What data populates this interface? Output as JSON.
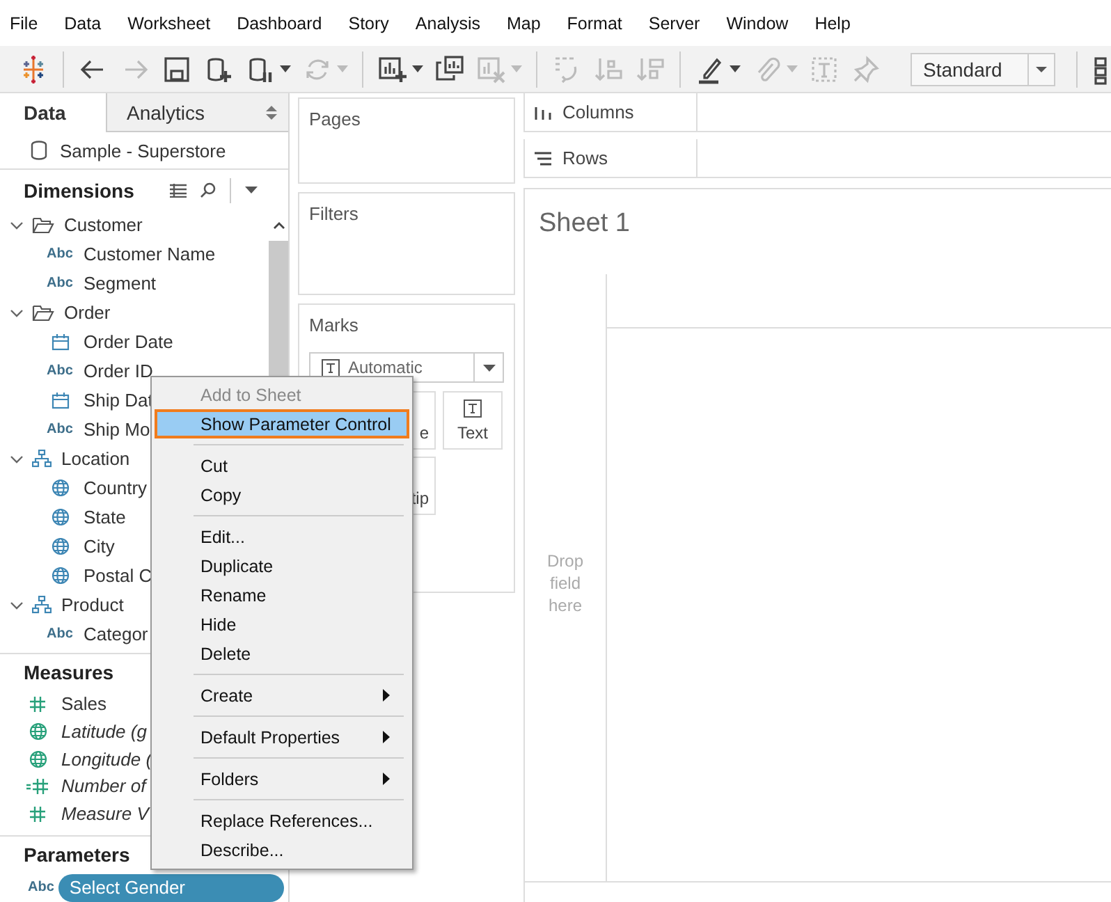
{
  "menu_bar": [
    "File",
    "Data",
    "Worksheet",
    "Dashboard",
    "Story",
    "Analysis",
    "Map",
    "Format",
    "Server",
    "Window",
    "Help"
  ],
  "toolbar": {
    "buttons": [
      {
        "kind": "logo",
        "disabled": false,
        "dropdown": false
      },
      {
        "kind": "separator"
      },
      {
        "kind": "back",
        "disabled": false,
        "dropdown": false
      },
      {
        "kind": "forward",
        "disabled": true,
        "dropdown": false
      },
      {
        "kind": "save",
        "disabled": false,
        "dropdown": false
      },
      {
        "kind": "new_datasource",
        "disabled": false,
        "dropdown": false
      },
      {
        "kind": "pause_datasource",
        "disabled": false,
        "dropdown": true
      },
      {
        "kind": "refresh",
        "disabled": true,
        "dropdown": true
      },
      {
        "kind": "separator"
      },
      {
        "kind": "new_sheet",
        "disabled": false,
        "dropdown": true
      },
      {
        "kind": "duplicate_sheet",
        "disabled": false,
        "dropdown": false
      },
      {
        "kind": "clear_sheet",
        "disabled": true,
        "dropdown": true
      },
      {
        "kind": "separator"
      },
      {
        "kind": "swap",
        "disabled": true,
        "dropdown": false
      },
      {
        "kind": "sort_ascending",
        "disabled": true,
        "dropdown": false
      },
      {
        "kind": "sort_descending",
        "disabled": true,
        "dropdown": false
      },
      {
        "kind": "separator"
      },
      {
        "kind": "highlight",
        "disabled": false,
        "dropdown": true
      },
      {
        "kind": "annotate",
        "disabled": true,
        "dropdown": true
      },
      {
        "kind": "labels",
        "disabled": true,
        "dropdown": false
      },
      {
        "kind": "pin",
        "disabled": true,
        "dropdown": false
      },
      {
        "kind": "fit"
      },
      {
        "kind": "separator"
      },
      {
        "kind": "cards",
        "disabled": false,
        "dropdown": false
      }
    ],
    "fit": "Standard"
  },
  "data_pane": {
    "tabs": [
      {
        "label": "Data",
        "selected": true
      },
      {
        "label": "Analytics",
        "selected": false
      }
    ],
    "datasource": "Sample - Superstore",
    "dimensions": {
      "title": "Dimensions",
      "items": [
        {
          "kind": "folder",
          "name": "Customer",
          "expanded": true,
          "children": [
            {
              "kind": "string",
              "type_label": "Abc",
              "name": "Customer Name"
            },
            {
              "kind": "string",
              "type_label": "Abc",
              "name": "Segment"
            }
          ]
        },
        {
          "kind": "folder",
          "name": "Order",
          "expanded": true,
          "children": [
            {
              "kind": "date",
              "name": "Order Date"
            },
            {
              "kind": "string",
              "type_label": "Abc",
              "name": "Order ID"
            },
            {
              "kind": "date",
              "name": "Ship Dat"
            },
            {
              "kind": "string",
              "type_label": "Abc",
              "name": "Ship Mo"
            }
          ]
        },
        {
          "kind": "hierarchy",
          "name": "Location",
          "expanded": true,
          "children": [
            {
              "kind": "geo",
              "name": "Country"
            },
            {
              "kind": "geo",
              "name": "State"
            },
            {
              "kind": "geo",
              "name": "City"
            },
            {
              "kind": "geo",
              "name": "Postal C"
            }
          ]
        },
        {
          "kind": "hierarchy",
          "name": "Product",
          "expanded": true,
          "children": [
            {
              "kind": "string",
              "type_label": "Abc",
              "name": "Categor"
            }
          ]
        }
      ]
    },
    "measures": {
      "title": "Measures",
      "items": [
        {
          "kind": "number",
          "name": "Sales",
          "generated": false
        },
        {
          "kind": "geo",
          "name": "Latitude (g",
          "generated": true
        },
        {
          "kind": "geo",
          "name": "Longitude (",
          "generated": true
        },
        {
          "kind": "calc_number",
          "name": "Number of",
          "generated": true
        },
        {
          "kind": "number",
          "name": "Measure V",
          "generated": true
        }
      ]
    },
    "parameters": {
      "title": "Parameters",
      "items": [
        {
          "type_label": "Abc",
          "name": "Select Gender",
          "selected": true
        }
      ]
    }
  },
  "shelves": {
    "pages": "Pages",
    "filters": "Filters",
    "marks": {
      "title": "Marks",
      "mark_type": "Automatic",
      "buttons": [
        "e",
        "Text",
        "tip"
      ]
    }
  },
  "view": {
    "columns": "Columns",
    "rows": "Rows",
    "sheet_title": "Sheet 1",
    "drop_hint": "Drop field here"
  },
  "context_menu": {
    "items": [
      {
        "kind": "item",
        "label": "Add to Sheet",
        "disabled": true,
        "selected": false
      },
      {
        "kind": "item",
        "label": "Show Parameter Control",
        "disabled": false,
        "selected": true
      },
      {
        "kind": "separator"
      },
      {
        "kind": "item",
        "label": "Cut",
        "disabled": false,
        "selected": false
      },
      {
        "kind": "item",
        "label": "Copy",
        "disabled": false,
        "selected": false
      },
      {
        "kind": "separator"
      },
      {
        "kind": "item",
        "label": "Edit...",
        "disabled": false,
        "selected": false
      },
      {
        "kind": "item",
        "label": "Duplicate",
        "disabled": false,
        "selected": false
      },
      {
        "kind": "item",
        "label": "Rename",
        "disabled": false,
        "selected": false
      },
      {
        "kind": "item",
        "label": "Hide",
        "disabled": false,
        "selected": false
      },
      {
        "kind": "item",
        "label": "Delete",
        "disabled": false,
        "selected": false
      },
      {
        "kind": "separator"
      },
      {
        "kind": "submenu",
        "label": "Create",
        "disabled": false,
        "selected": false
      },
      {
        "kind": "separator"
      },
      {
        "kind": "submenu",
        "label": "Default Properties",
        "disabled": false,
        "selected": false
      },
      {
        "kind": "separator"
      },
      {
        "kind": "submenu",
        "label": "Folders",
        "disabled": false,
        "selected": false
      },
      {
        "kind": "separator"
      },
      {
        "kind": "item",
        "label": "Replace References...",
        "disabled": false,
        "selected": false
      },
      {
        "kind": "item",
        "label": "Describe...",
        "disabled": false,
        "selected": false
      }
    ]
  }
}
